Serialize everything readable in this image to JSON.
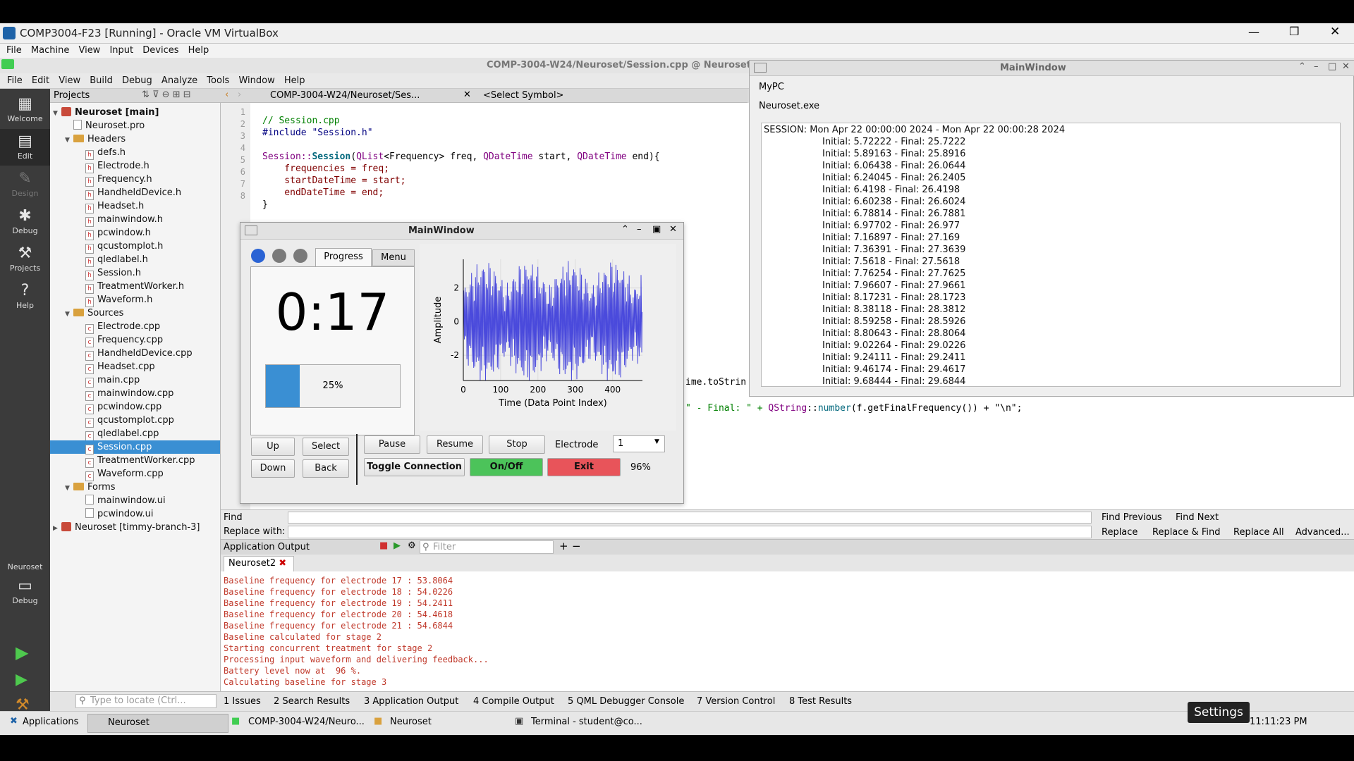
{
  "vbox": {
    "title": "COMP3004-F23 [Running] - Oracle VM VirtualBox",
    "menu": [
      "File",
      "Machine",
      "View",
      "Input",
      "Devices",
      "Help"
    ]
  },
  "qc": {
    "path_title": "COMP-3004-W24/Neuroset/Session.cpp @ Neuroset [m",
    "menu": [
      "File",
      "Edit",
      "View",
      "Build",
      "Debug",
      "Analyze",
      "Tools",
      "Window",
      "Help"
    ],
    "modes": [
      "Welcome",
      "Edit",
      "Design",
      "Debug",
      "Projects",
      "Help"
    ],
    "kit_label": "Neuroset",
    "kit_mode": "Debug",
    "projects_label": "Projects",
    "editor_file": "COMP-3004-W24/Neuroset/Ses...",
    "symbol": "<Select Symbol>"
  },
  "tree": [
    {
      "t": "Neuroset [main]",
      "lv": 0,
      "k": "pro",
      "bold": true,
      "a": "▼"
    },
    {
      "t": "Neuroset.pro",
      "lv": 1,
      "k": "file"
    },
    {
      "t": "Headers",
      "lv": 1,
      "k": "folder",
      "a": "▼"
    },
    {
      "t": "defs.h",
      "lv": 2,
      "k": "h"
    },
    {
      "t": "Electrode.h",
      "lv": 2,
      "k": "h"
    },
    {
      "t": "Frequency.h",
      "lv": 2,
      "k": "h"
    },
    {
      "t": "HandheldDevice.h",
      "lv": 2,
      "k": "h"
    },
    {
      "t": "Headset.h",
      "lv": 2,
      "k": "h"
    },
    {
      "t": "mainwindow.h",
      "lv": 2,
      "k": "h"
    },
    {
      "t": "pcwindow.h",
      "lv": 2,
      "k": "h"
    },
    {
      "t": "qcustomplot.h",
      "lv": 2,
      "k": "h"
    },
    {
      "t": "qledlabel.h",
      "lv": 2,
      "k": "h"
    },
    {
      "t": "Session.h",
      "lv": 2,
      "k": "h"
    },
    {
      "t": "TreatmentWorker.h",
      "lv": 2,
      "k": "h"
    },
    {
      "t": "Waveform.h",
      "lv": 2,
      "k": "h"
    },
    {
      "t": "Sources",
      "lv": 1,
      "k": "folder",
      "a": "▼"
    },
    {
      "t": "Electrode.cpp",
      "lv": 2,
      "k": "c"
    },
    {
      "t": "Frequency.cpp",
      "lv": 2,
      "k": "c"
    },
    {
      "t": "HandheldDevice.cpp",
      "lv": 2,
      "k": "c"
    },
    {
      "t": "Headset.cpp",
      "lv": 2,
      "k": "c"
    },
    {
      "t": "main.cpp",
      "lv": 2,
      "k": "c"
    },
    {
      "t": "mainwindow.cpp",
      "lv": 2,
      "k": "c"
    },
    {
      "t": "pcwindow.cpp",
      "lv": 2,
      "k": "c"
    },
    {
      "t": "qcustomplot.cpp",
      "lv": 2,
      "k": "c"
    },
    {
      "t": "qledlabel.cpp",
      "lv": 2,
      "k": "c"
    },
    {
      "t": "Session.cpp",
      "lv": 2,
      "k": "c",
      "sel": true
    },
    {
      "t": "TreatmentWorker.cpp",
      "lv": 2,
      "k": "c"
    },
    {
      "t": "Waveform.cpp",
      "lv": 2,
      "k": "c"
    },
    {
      "t": "Forms",
      "lv": 1,
      "k": "folder",
      "a": "▼"
    },
    {
      "t": "mainwindow.ui",
      "lv": 2,
      "k": "ui"
    },
    {
      "t": "pcwindow.ui",
      "lv": 2,
      "k": "ui"
    },
    {
      "t": "Neuroset [timmy-branch-3]",
      "lv": 0,
      "k": "pro",
      "a": "▶"
    }
  ],
  "code": {
    "line1": "// Session.cpp",
    "line2": "#include \"Session.h\"",
    "line4a": "Session::",
    "line4b": "Session",
    "line4c": "(",
    "line4d": "QList",
    "line4e": "<Frequency> freq, ",
    "line4f": "QDateTime",
    "line4g": " start, ",
    "line4h": "QDateTime",
    "line4i": " end){",
    "line5": "    frequencies = freq;",
    "line6": "    startDateTime = start;",
    "line7": "    endDateTime = end;",
    "line8": "}",
    "frag1": "ime.toStrin",
    "frag2a": "\" - Final: \" + ",
    "frag2b": "QString",
    "frag2c": "::",
    "frag2d": "number",
    "frag2e": "(f.getFinalFrequency()) + \"\\n\";"
  },
  "find": {
    "label": "Find",
    "replace_label": "Replace with:",
    "find_prev": "Find Previous",
    "find_next": "Find Next",
    "replace": "Replace",
    "replace_find": "Replace & Find",
    "replace_all": "Replace All",
    "advanced": "Advanced..."
  },
  "output": {
    "title": "Application Output",
    "filter": "Filter",
    "tab": "Neuroset2",
    "lines": [
      "Baseline frequency for electrode 17 : 53.8064",
      "Baseline frequency for electrode 18 : 54.0226",
      "Baseline frequency for electrode 19 : 54.2411",
      "Baseline frequency for electrode 20 : 54.4618",
      "Baseline frequency for electrode 21 : 54.6844",
      "Baseline calculated for stage 2",
      "Starting concurrent treatment for stage 2",
      "Processing input waveform and delivering feedback...",
      "Battery level now at  96 %.",
      "Calculating baseline for stage 3"
    ]
  },
  "status": {
    "locate": "Type to locate (Ctrl...",
    "tabs": [
      "1 Issues",
      "2 Search Results",
      "3 Application Output",
      "4 Compile Output",
      "5 QML Debugger Console",
      "7 Version Control",
      "8 Test Results"
    ]
  },
  "taskbar": {
    "apps": "Applications",
    "items": [
      "Neuroset",
      "COMP-3004-W24/Neuro...",
      "Neuroset",
      "Terminal - student@co..."
    ],
    "clock": "11:11:23 PM",
    "tooltip": "Settings"
  },
  "mypc": {
    "title": "MainWindow",
    "pc": "MyPC",
    "exe": "Neuroset.exe",
    "session": "SESSION: Mon Apr 22 00:00:00 2024 - Mon Apr 22 00:00:28 2024",
    "rows": [
      "Initial: 5.72222 - Final: 25.7222",
      "Initial: 5.89163 - Final: 25.8916",
      "Initial: 6.06438 - Final: 26.0644",
      "Initial: 6.24045 - Final: 26.2405",
      "Initial: 6.4198 - Final: 26.4198",
      "Initial: 6.60238 - Final: 26.6024",
      "Initial: 6.78814 - Final: 26.7881",
      "Initial: 6.97702 - Final: 26.977",
      "Initial: 7.16897 - Final: 27.169",
      "Initial: 7.36391 - Final: 27.3639",
      "Initial: 7.5618 - Final: 27.5618",
      "Initial: 7.76254 - Final: 27.7625",
      "Initial: 7.96607 - Final: 27.9661",
      "Initial: 8.17231 - Final: 28.1723",
      "Initial: 8.38118 - Final: 28.3812",
      "Initial: 8.59258 - Final: 28.5926",
      "Initial: 8.80643 - Final: 28.8064",
      "Initial: 9.02264 - Final: 29.0226",
      "Initial: 9.24111 - Final: 29.2411",
      "Initial: 9.46174 - Final: 29.4617",
      "Initial: 9.68444 - Final: 29.6844"
    ]
  },
  "device": {
    "title": "MainWindow",
    "tab_progress": "Progress",
    "tab_menu": "Menu",
    "timer": "0:17",
    "progress": 25,
    "progress_label": "25%",
    "btn_up": "Up",
    "btn_select": "Select",
    "btn_down": "Down",
    "btn_back": "Back",
    "btn_pause": "Pause",
    "btn_resume": "Resume",
    "btn_stop": "Stop",
    "electrode_label": "Electrode",
    "electrode_value": "1",
    "btn_toggle": "Toggle Connection",
    "btn_onoff": "On/Off",
    "btn_exit": "Exit",
    "battery": "96%",
    "colors": {
      "onoff": "#4cc35a",
      "exit": "#e8545a",
      "dot_blue": "#2a63d4",
      "dot_gray": "#7a7a7a",
      "progress": "#3a8fd3"
    }
  },
  "chart_data": {
    "type": "line",
    "xlabel": "Time (Data Point Index)",
    "ylabel": "Amplitude",
    "xlim": [
      0,
      480
    ],
    "ylim": [
      -3.5,
      3.7
    ],
    "xticks": [
      0,
      100,
      200,
      300,
      400
    ],
    "yticks": [
      2,
      0,
      -2
    ],
    "n_points": 500,
    "series": [
      {
        "color": "#4a4adc"
      }
    ]
  }
}
